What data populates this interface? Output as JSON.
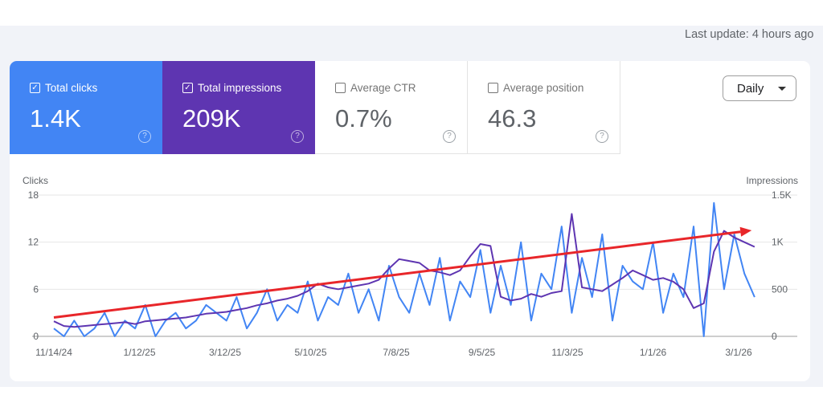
{
  "header": {
    "last_update": "Last update: 4 hours ago"
  },
  "metrics": [
    {
      "label": "Total clicks",
      "value": "1.4K",
      "checked": true,
      "color": "#4285f4"
    },
    {
      "label": "Total impressions",
      "value": "209K",
      "checked": true,
      "color": "#5e35b1"
    },
    {
      "label": "Average CTR",
      "value": "0.7%",
      "checked": false
    },
    {
      "label": "Average position",
      "value": "46.3",
      "checked": false
    }
  ],
  "granularity": {
    "selected": "Daily"
  },
  "chart_data": {
    "type": "line",
    "ylabel": "Clicks",
    "y2label": "Impressions",
    "ylim": [
      0,
      18
    ],
    "y2lim": [
      0,
      1500
    ],
    "yticks": [
      "0",
      "6",
      "12",
      "18"
    ],
    "y2ticks": [
      "0",
      "500",
      "1K",
      "1.5K"
    ],
    "xticks": [
      {
        "date": "2024-11-14",
        "label": "11/14/24"
      },
      {
        "date": "2025-01-12",
        "label": "1/12/25"
      },
      {
        "date": "2025-03-12",
        "label": "3/12/25"
      },
      {
        "date": "2025-05-10",
        "label": "5/10/25"
      },
      {
        "date": "2025-07-08",
        "label": "7/8/25"
      },
      {
        "date": "2025-09-05",
        "label": "9/5/25"
      },
      {
        "date": "2025-11-03",
        "label": "11/3/25"
      },
      {
        "date": "2026-01-01",
        "label": "1/1/26"
      },
      {
        "date": "2026-03-01",
        "label": "3/1/26"
      }
    ],
    "grid": true,
    "x": [
      "2024-11-14",
      "2024-11-21",
      "2024-11-28",
      "2024-12-05",
      "2024-12-12",
      "2024-12-19",
      "2024-12-26",
      "2025-01-02",
      "2025-01-09",
      "2025-01-16",
      "2025-01-23",
      "2025-01-30",
      "2025-02-06",
      "2025-02-13",
      "2025-02-20",
      "2025-02-27",
      "2025-03-06",
      "2025-03-13",
      "2025-03-20",
      "2025-03-27",
      "2025-04-03",
      "2025-04-10",
      "2025-04-17",
      "2025-04-24",
      "2025-05-01",
      "2025-05-08",
      "2025-05-15",
      "2025-05-22",
      "2025-05-29",
      "2025-06-05",
      "2025-06-12",
      "2025-06-19",
      "2025-06-26",
      "2025-07-03",
      "2025-07-10",
      "2025-07-17",
      "2025-07-24",
      "2025-07-31",
      "2025-08-07",
      "2025-08-14",
      "2025-08-21",
      "2025-08-28",
      "2025-09-04",
      "2025-09-11",
      "2025-09-18",
      "2025-09-25",
      "2025-10-02",
      "2025-10-09",
      "2025-10-16",
      "2025-10-23",
      "2025-10-30",
      "2025-11-06",
      "2025-11-13",
      "2025-11-20",
      "2025-11-27",
      "2025-12-04",
      "2025-12-11",
      "2025-12-18",
      "2025-12-25",
      "2026-01-01",
      "2026-01-08",
      "2026-01-15",
      "2026-01-22",
      "2026-01-29",
      "2026-02-05",
      "2026-02-12",
      "2026-02-19",
      "2026-02-26",
      "2026-03-05",
      "2026-03-12"
    ],
    "series": [
      {
        "name": "Clicks",
        "axis": "left",
        "color": "#4285f4",
        "values": [
          1,
          0,
          2,
          0,
          1,
          3,
          0,
          2,
          1,
          4,
          0,
          2,
          3,
          1,
          2,
          4,
          3,
          2,
          5,
          1,
          3,
          6,
          2,
          4,
          3,
          7,
          2,
          5,
          4,
          8,
          3,
          6,
          2,
          9,
          5,
          3,
          8,
          4,
          10,
          2,
          7,
          5,
          11,
          3,
          9,
          4,
          12,
          2,
          8,
          6,
          14,
          3,
          10,
          5,
          13,
          2,
          9,
          7,
          6,
          12,
          3,
          8,
          5,
          14,
          0,
          17,
          6,
          13,
          8,
          5
        ]
      },
      {
        "name": "Impressions",
        "axis": "right",
        "color": "#5e35b1",
        "values": [
          160,
          110,
          100,
          110,
          120,
          130,
          140,
          150,
          130,
          160,
          170,
          180,
          190,
          200,
          220,
          240,
          250,
          260,
          280,
          300,
          330,
          350,
          380,
          400,
          430,
          480,
          560,
          520,
          500,
          520,
          540,
          560,
          600,
          720,
          820,
          800,
          780,
          700,
          680,
          650,
          700,
          850,
          980,
          960,
          420,
          380,
          400,
          450,
          420,
          460,
          480,
          1300,
          520,
          500,
          480,
          550,
          620,
          700,
          650,
          600,
          620,
          580,
          500,
          300,
          350,
          900,
          1120,
          1050,
          1000,
          950
        ]
      }
    ],
    "annotations": [
      {
        "type": "trend-arrow",
        "color": "#e8262a",
        "from": {
          "x": "2024-11-14",
          "y": 2.4
        },
        "to": {
          "x": "2026-03-10",
          "y": 13.5
        }
      }
    ]
  }
}
